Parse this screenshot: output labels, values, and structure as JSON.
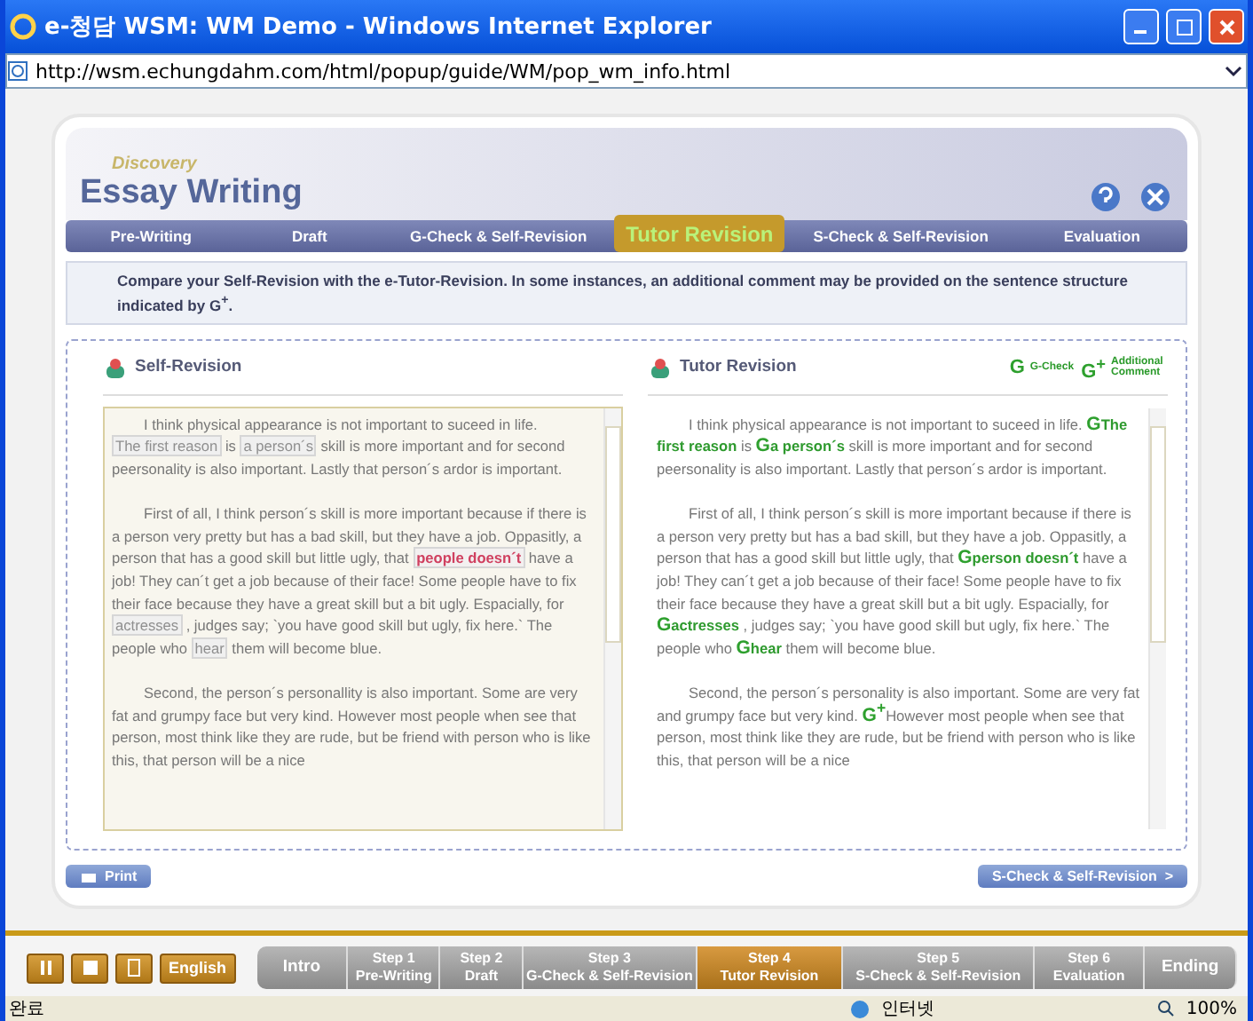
{
  "window": {
    "title": "e-청담 WSM: WM Demo - Windows Internet Explorer",
    "address": "http://wsm.echungdahm.com/html/popup/guide/WM/pop_wm_info.html"
  },
  "app": {
    "logo_small": "Discovery",
    "logo": "Essay Writing"
  },
  "tabs": [
    {
      "label": "Pre-Writing",
      "selected": false
    },
    {
      "label": "Draft",
      "selected": false
    },
    {
      "label": "G-Check & Self-Revision",
      "selected": false
    },
    {
      "label": "Tutor Revision",
      "selected": true
    },
    {
      "label": "S-Check & Self-Revision",
      "selected": false
    },
    {
      "label": "Evaluation",
      "selected": false
    }
  ],
  "instruction": "Compare your Self-Revision with the e-Tutor-Revision. In some instances, an additional comment may be provided on the sentence structure indicated by G$^{+}$.",
  "panels": [
    {
      "title": "Self-Revision",
      "paragraphs": [
        [
          {
            "kind": "plain",
            "text": "I think physical appearance is not important to suceed in life. "
          },
          {
            "kind": "blank",
            "text": "The first reason"
          },
          {
            "kind": "plain",
            "text": " is "
          },
          {
            "kind": "blank",
            "text": "a person´s"
          },
          {
            "kind": "plain",
            "text": " skill is more important and for second peersonality is also important. Lastly that person´s ardor is important."
          }
        ],
        [
          {
            "kind": "plain",
            "text": "First of all, I think person´s skill is more important because if there is a person very pretty but has a bad skill, but they have a job. Oppasitly, a person that has a good skill but little ugly, that "
          },
          {
            "kind": "error",
            "text": "people doesn´t"
          },
          {
            "kind": "plain",
            "text": " have a job! They can´t get a job because of their face! Some people have to fix their face because they have a great skill but a bit ugly. Espacially, for "
          },
          {
            "kind": "blank",
            "text": "actresses"
          },
          {
            "kind": "plain",
            "text": " , judges say; `you have good skill but ugly, fix here.` The people who "
          },
          {
            "kind": "blank",
            "text": "hear"
          },
          {
            "kind": "plain",
            "text": " them will become blue."
          }
        ],
        [
          {
            "kind": "plain",
            "text": "Second, the person´s personallity is also important. Some are very fat and grumpy face but very kind. However most people when see that person, most think like they are rude, but be friend with person who is like this, that person will be a nice"
          }
        ]
      ]
    },
    {
      "title": "Tutor Revision",
      "legend": [
        {
          "mark": "G",
          "label": "G-Check"
        },
        {
          "mark": "G$^{+}$",
          "label": "Additional Comment"
        }
      ],
      "paragraphs": [
        [
          {
            "kind": "plain",
            "text": "I think physical appearance is not important to suceed in life. "
          },
          {
            "kind": "mark",
            "text": "G"
          },
          {
            "kind": "gcheck",
            "text": "The first reason"
          },
          {
            "kind": "plain",
            "text": " is "
          },
          {
            "kind": "mark",
            "text": "G"
          },
          {
            "kind": "gcheck",
            "text": "a person´s"
          },
          {
            "kind": "plain",
            "text": " skill is more important and for second peersonality is also important. Lastly that person´s ardor is important."
          }
        ],
        [
          {
            "kind": "plain",
            "text": "First of all, I think person´s skill is more important because if there is a person very pretty but has a bad skill, but they have a job. Oppasitly, a person that has a good skill but little ugly, that "
          },
          {
            "kind": "mark",
            "text": "G"
          },
          {
            "kind": "gcheck",
            "text": "person doesn´t"
          },
          {
            "kind": "plain",
            "text": " have a job! They can´t get a job because of their face! Some people have to fix their face because they have a great skill but a bit ugly. Espacially, for "
          },
          {
            "kind": "mark",
            "text": "G"
          },
          {
            "kind": "gcheck",
            "text": "actresses"
          },
          {
            "kind": "plain",
            "text": " , judges say; `you have good skill but ugly, fix here.` The people who "
          },
          {
            "kind": "mark",
            "text": "G"
          },
          {
            "kind": "gcheck",
            "text": "hear"
          },
          {
            "kind": "plain",
            "text": " them will become blue."
          }
        ],
        [
          {
            "kind": "plain",
            "text": "Second, the person´s personality is also important. Some are very fat and grumpy face but very kind. "
          },
          {
            "kind": "mark",
            "text": "G$^{+}$"
          },
          {
            "kind": "plain",
            "text": "However most people when see that person, most think like they are rude, but be friend with person who is like this, that person will be a nice"
          }
        ]
      ]
    }
  ],
  "print_button": "Print",
  "next_button": "S-Check & Self-Revision  >",
  "controls": {
    "language": "English"
  },
  "steps": [
    {
      "label": "Intro",
      "selected": false
    },
    {
      "label": "Step 1",
      "sub": "Pre-Writing",
      "selected": false
    },
    {
      "label": "Step 2",
      "sub": "Draft",
      "selected": false
    },
    {
      "label": "Step 3",
      "sub": "G-Check & Self-Revision",
      "selected": false
    },
    {
      "label": "Step 4",
      "sub": "Tutor Revision",
      "selected": true
    },
    {
      "label": "Step 5",
      "sub": "S-Check & Self-Revision",
      "selected": false
    },
    {
      "label": "Step 6",
      "sub": "Evaluation",
      "selected": false
    },
    {
      "label": "Ending",
      "selected": false
    }
  ],
  "status_bar": {
    "status": "완료",
    "zone": "인터넷",
    "zoom": "100%"
  }
}
